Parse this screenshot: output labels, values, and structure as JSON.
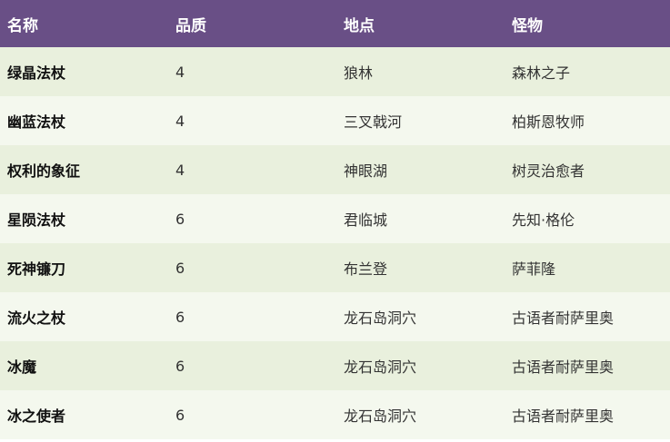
{
  "table": {
    "headers": [
      "名称",
      "品质",
      "地点",
      "怪物"
    ],
    "rows": [
      [
        "绿晶法杖",
        "4",
        "狼林",
        "森林之子"
      ],
      [
        "幽蓝法杖",
        "4",
        "三叉戟河",
        "柏斯恩牧师"
      ],
      [
        "权利的象征",
        "4",
        "神眼湖",
        "树灵治愈者"
      ],
      [
        "星陨法杖",
        "6",
        "君临城",
        "先知·格伦"
      ],
      [
        "死神镰刀",
        "6",
        "布兰登",
        "萨菲隆"
      ],
      [
        "流火之杖",
        "6",
        "龙石岛洞穴",
        "古语者耐萨里奥"
      ],
      [
        "冰魔",
        "6",
        "龙石岛洞穴",
        "古语者耐萨里奥"
      ],
      [
        "冰之使者",
        "6",
        "龙石岛洞穴",
        "古语者耐萨里奥"
      ]
    ]
  },
  "colors": {
    "header_bg": "#694f86",
    "row_a": "#e9f0dd",
    "row_b": "#f4f8ee"
  }
}
